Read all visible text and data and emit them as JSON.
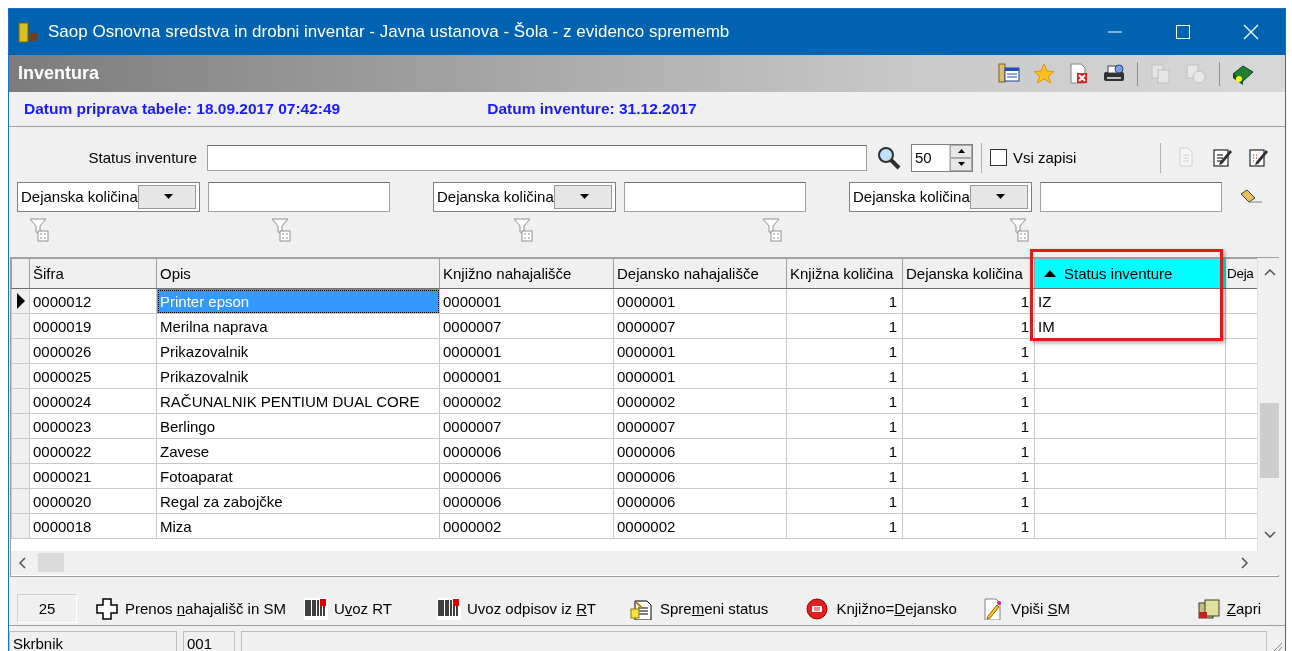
{
  "window": {
    "title": "Saop Osnovna sredstva in drobni inventar - Javna ustanova - Šola - z evidenco sprememb"
  },
  "panel": {
    "title": "Inventura",
    "toolbar": [
      {
        "kind": "columns",
        "disabled": false
      },
      {
        "kind": "favorite",
        "disabled": false
      },
      {
        "kind": "delete",
        "disabled": false
      },
      {
        "kind": "print",
        "disabled": false
      },
      {
        "kind": "copy",
        "disabled": true
      },
      {
        "kind": "paste",
        "disabled": true
      },
      {
        "kind": "help",
        "disabled": false
      }
    ]
  },
  "dates": [
    "Datum priprava tabele: 18.09.2017 07:42:49",
    "Datum inventure: 31.12.2017"
  ],
  "search": {
    "label": "Status inventure",
    "page_size": "50",
    "all_records": {
      "label": "Vsi zapisi",
      "checked": false
    },
    "tools": [
      {
        "kind": "new",
        "disabled": true
      },
      {
        "kind": "edit",
        "disabled": false
      },
      {
        "kind": "edit_all",
        "disabled": false
      }
    ]
  },
  "filters": [
    {
      "field": "Dejanska količina"
    },
    {
      "field": "Dejanska količina"
    },
    {
      "field": "Dejanska količina"
    }
  ],
  "grid": {
    "columns": [
      {
        "label": "Šifra",
        "kind": "text",
        "sorted": false,
        "highlighted": false
      },
      {
        "label": "Opis",
        "kind": "text",
        "sorted": false,
        "highlighted": false,
        "focused": true
      },
      {
        "label": "Knjižno nahajališče",
        "kind": "text",
        "sorted": false,
        "highlighted": false
      },
      {
        "label": "Dejansko nahajališče",
        "kind": "text",
        "sorted": false,
        "highlighted": false
      },
      {
        "label": "Knjižna količina",
        "kind": "number",
        "sorted": false,
        "highlighted": false
      },
      {
        "label": "Dejanska količina",
        "kind": "number",
        "sorted": false,
        "highlighted": false
      },
      {
        "label": "Status inventure",
        "kind": "text",
        "sorted": true,
        "highlighted": true
      },
      {
        "label": "Deja",
        "kind": "text",
        "sorted": false,
        "highlighted": false
      }
    ],
    "rows": [
      {
        "selected": true,
        "cells": [
          "0000012",
          "Printer epson",
          "0000001",
          "0000001",
          "1",
          "1",
          "IZ"
        ]
      },
      {
        "selected": false,
        "cells": [
          "0000019",
          "Merilna naprava",
          "0000007",
          "0000007",
          "1",
          "1",
          "IM"
        ]
      },
      {
        "selected": false,
        "cells": [
          "0000026",
          "Prikazovalnik",
          "0000001",
          "0000001",
          "1",
          "1"
        ]
      },
      {
        "selected": false,
        "cells": [
          "0000025",
          "Prikazovalnik",
          "0000001",
          "0000001",
          "1",
          "1"
        ]
      },
      {
        "selected": false,
        "cells": [
          "0000024",
          "RAČUNALNIK PENTIUM DUAL CORE",
          "0000002",
          "0000002",
          "1",
          "1"
        ]
      },
      {
        "selected": false,
        "cells": [
          "0000023",
          "Berlingo",
          "0000007",
          "0000007",
          "1",
          "1"
        ]
      },
      {
        "selected": false,
        "cells": [
          "0000022",
          "Zavese",
          "0000006",
          "0000006",
          "1",
          "1"
        ]
      },
      {
        "selected": false,
        "cells": [
          "0000021",
          "Fotoaparat",
          "0000006",
          "0000006",
          "1",
          "1"
        ]
      },
      {
        "selected": false,
        "cells": [
          "0000020",
          "Regal za zabojčke",
          "0000006",
          "0000006",
          "1",
          "1"
        ]
      },
      {
        "selected": false,
        "cells": [
          "0000018",
          "Miza",
          "0000002",
          "0000002",
          "1",
          "1"
        ]
      }
    ]
  },
  "record_count": "25",
  "actions": [
    {
      "kind": "transfer",
      "before": "Prenos ",
      "key": "n",
      "after": "ahajališč in SM"
    },
    {
      "kind": "barcode",
      "before": "U",
      "key": "v",
      "after": "oz RT"
    },
    {
      "kind": "barcode",
      "before": "Uvoz odpisov iz ",
      "key": "R",
      "after": "T"
    },
    {
      "kind": "status",
      "before": "Spre",
      "key": "m",
      "after": "eni status"
    },
    {
      "kind": "equal",
      "before": "Knjižno=",
      "key": "D",
      "after": "ejansko"
    },
    {
      "kind": "write",
      "before": "Vpiši ",
      "key": "S",
      "after": "M"
    },
    {
      "kind": "close",
      "key": "Z",
      "after": "apri"
    }
  ],
  "status_bar": [
    "Skrbnik",
    "001"
  ]
}
